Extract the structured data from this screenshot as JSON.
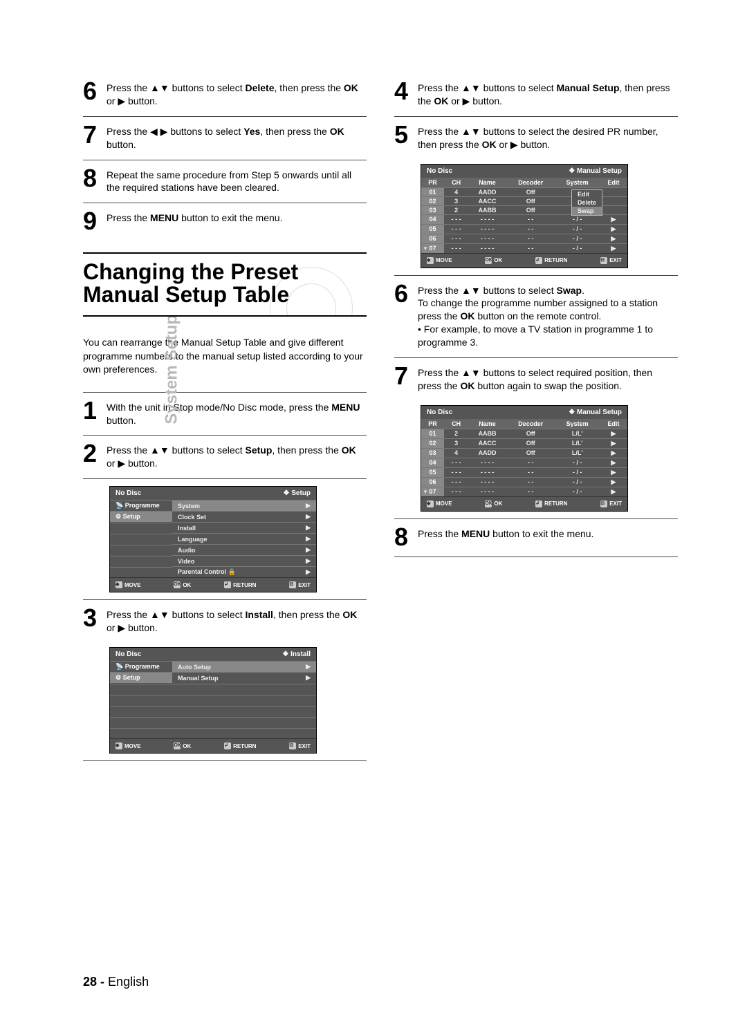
{
  "sidebar_label": "System Setup",
  "page_footer": {
    "number": "28 -",
    "lang": "English"
  },
  "left": {
    "steps_top": [
      {
        "num": "6",
        "html": "Press the ▲▼ buttons to select <strong>Delete</strong>, then press the <strong>OK</strong> or ▶ button."
      },
      {
        "num": "7",
        "html": "Press the ◀ ▶ buttons to select <strong>Yes</strong>, then press the <strong>OK</strong> button."
      },
      {
        "num": "8",
        "html": "Repeat the same procedure from Step 5 onwards until all the required stations have been cleared."
      },
      {
        "num": "9",
        "html": "Press the <strong>MENU</strong> button to exit the menu."
      }
    ],
    "heading": "Changing the Preset Manual Setup Table",
    "intro": "You can rearrange the Manual Setup Table and give different programme numbers to the manual setup listed according to your own preferences.",
    "steps_bottom": [
      {
        "num": "1",
        "html": "With the unit in Stop mode/No Disc mode, press the <strong>MENU</strong> button."
      },
      {
        "num": "2",
        "html": "Press the ▲▼ buttons to select <strong>Setup</strong>, then press the <strong>OK</strong> or ▶ button."
      },
      {
        "num": "3",
        "html": "Press the ▲▼ buttons to select <strong>Install</strong>, then press the <strong>OK</strong> or ▶ button."
      }
    ]
  },
  "right": {
    "steps_top": [
      {
        "num": "4",
        "html": "Press the ▲▼ buttons to select <strong>Manual Setup</strong>, then press the <strong>OK</strong> or ▶ button."
      },
      {
        "num": "5",
        "html": "Press the ▲▼ buttons to select the desired PR number, then press the <strong>OK</strong> or ▶ button."
      }
    ],
    "steps_mid": [
      {
        "num": "6",
        "html": "Press the ▲▼ buttons to select <strong>Swap</strong>.<br>To change the programme number assigned to a station press the <strong>OK</strong> button on the remote control.",
        "sub": "For example, to move a TV station in programme 1 to programme 3."
      },
      {
        "num": "7",
        "html": "Press the ▲▼ buttons to select required position, then press the <strong>OK</strong> button again to swap the position."
      }
    ],
    "steps_bottom": [
      {
        "num": "8",
        "html": "Press the <strong>MENU</strong> button to exit the menu."
      }
    ]
  },
  "osd_setup": {
    "title_left": "No Disc",
    "title_right": "Setup",
    "side": [
      "Programme",
      "Setup"
    ],
    "items": [
      "System",
      "Clock Set",
      "Install",
      "Language",
      "Audio",
      "Video",
      "Parental Control"
    ],
    "selected": 0,
    "lock_index": 6,
    "foot": [
      "MOVE",
      "OK",
      "RETURN",
      "EXIT"
    ]
  },
  "osd_install": {
    "title_left": "No Disc",
    "title_right": "Install",
    "side": [
      "Programme",
      "Setup"
    ],
    "items": [
      "Auto Setup",
      "Manual Setup"
    ],
    "selected": 0,
    "foot": [
      "MOVE",
      "OK",
      "RETURN",
      "EXIT"
    ]
  },
  "osd_manual1": {
    "title_left": "No Disc",
    "title_right": "Manual Setup",
    "headers": [
      "PR",
      "CH",
      "Name",
      "Decoder",
      "System",
      "Edit"
    ],
    "menu": [
      "Edit",
      "Delete",
      "Swap"
    ],
    "rows": [
      {
        "pr": "01",
        "ch": "4",
        "name": "AADD",
        "dec": "Off",
        "sys": "menu",
        "edit": ""
      },
      {
        "pr": "02",
        "ch": "3",
        "name": "AACC",
        "dec": "Off",
        "sys": "",
        "edit": ""
      },
      {
        "pr": "03",
        "ch": "2",
        "name": "AABB",
        "dec": "Off",
        "sys": "",
        "edit": ""
      },
      {
        "pr": "04",
        "ch": "- - -",
        "name": "- - - -",
        "dec": "- -",
        "sys": "- / -",
        "edit": "▶"
      },
      {
        "pr": "05",
        "ch": "- - -",
        "name": "- - - -",
        "dec": "- -",
        "sys": "- / -",
        "edit": "▶"
      },
      {
        "pr": "06",
        "ch": "- - -",
        "name": "- - - -",
        "dec": "- -",
        "sys": "- / -",
        "edit": "▶"
      },
      {
        "pr": "07",
        "ch": "- - -",
        "name": "- - - -",
        "dec": "- -",
        "sys": "- / -",
        "edit": "▶"
      }
    ],
    "foot": [
      "MOVE",
      "OK",
      "RETURN",
      "EXIT"
    ]
  },
  "osd_manual2": {
    "title_left": "No Disc",
    "title_right": "Manual Setup",
    "headers": [
      "PR",
      "CH",
      "Name",
      "Decoder",
      "System",
      "Edit"
    ],
    "rows": [
      {
        "pr": "01",
        "ch": "2",
        "name": "AABB",
        "dec": "Off",
        "sys": "L/L'",
        "edit": "▶"
      },
      {
        "pr": "02",
        "ch": "3",
        "name": "AACC",
        "dec": "Off",
        "sys": "L/L'",
        "edit": "▶"
      },
      {
        "pr": "03",
        "ch": "4",
        "name": "AADD",
        "dec": "Off",
        "sys": "L/L'",
        "edit": "▶"
      },
      {
        "pr": "04",
        "ch": "- - -",
        "name": "- - - -",
        "dec": "- -",
        "sys": "- / -",
        "edit": "▶"
      },
      {
        "pr": "05",
        "ch": "- - -",
        "name": "- - - -",
        "dec": "- -",
        "sys": "- / -",
        "edit": "▶"
      },
      {
        "pr": "06",
        "ch": "- - -",
        "name": "- - - -",
        "dec": "- -",
        "sys": "- / -",
        "edit": "▶"
      },
      {
        "pr": "07",
        "ch": "- - -",
        "name": "- - - -",
        "dec": "- -",
        "sys": "- / -",
        "edit": "▶"
      }
    ],
    "foot": [
      "MOVE",
      "OK",
      "RETURN",
      "EXIT"
    ]
  }
}
